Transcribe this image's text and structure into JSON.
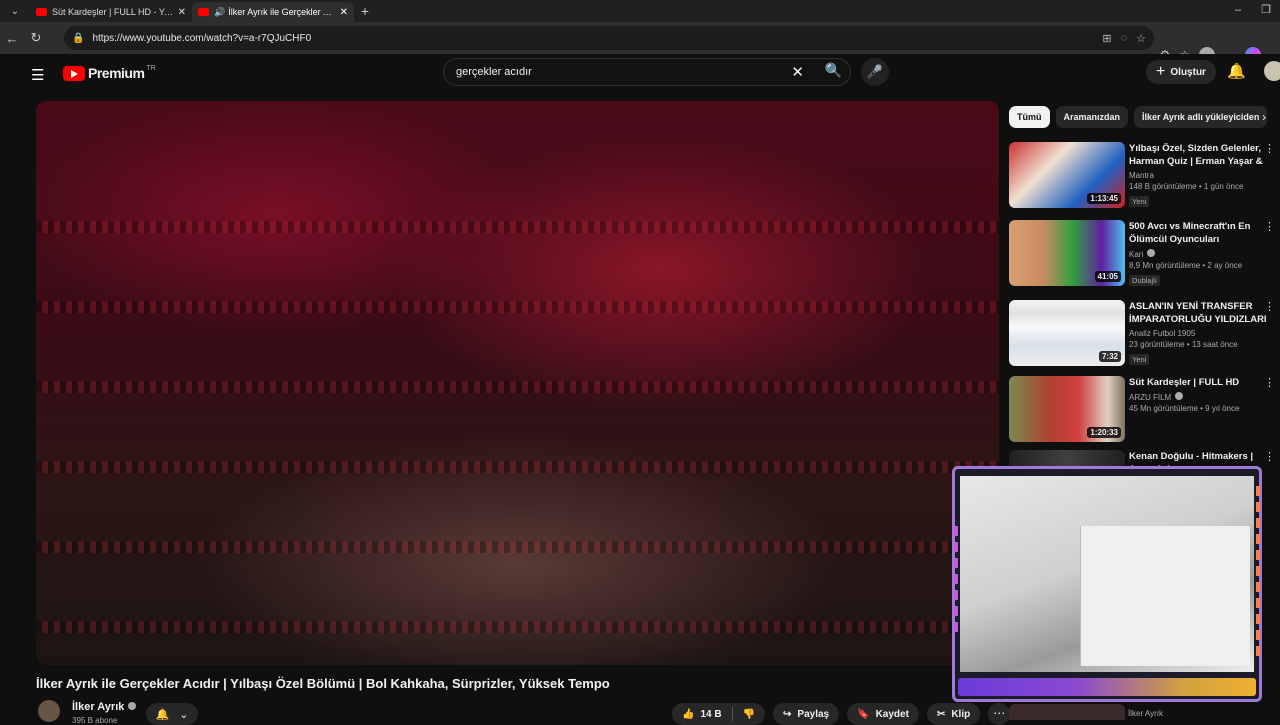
{
  "browser": {
    "tabs": [
      {
        "title": "Süt Kardeşler | FULL HD - YouTube",
        "active": false,
        "audio": false
      },
      {
        "title": "İlker Ayrık ile Gerçekler Acıdır | Yı",
        "active": true,
        "audio": true
      }
    ],
    "url": "https://www.youtube.com/watch?v=a-r7QJuCHF0"
  },
  "header": {
    "logo": "Premium",
    "region": "TR",
    "search_value": "gerçekler acıdır",
    "create_label": "Oluştur"
  },
  "video": {
    "title": "İlker Ayrık ile Gerçekler Acıdır | Yılbaşı Özel Bölümü | Bol Kahkaha, Sürprizler, Yüksek Tempo",
    "channel": "İlker Ayrık",
    "subscribers": "395 B abone",
    "likes": "14 B",
    "share_label": "Paylaş",
    "save_label": "Kaydet",
    "clip_label": "Klip"
  },
  "sidebar": {
    "chips": [
      "Tümü",
      "Aramanızdan",
      "İlker Ayrık adlı yükleyiciden"
    ],
    "recommendations": [
      {
        "title": "Yılbaşı Özel, Sizden Gelenler, Harman Quiz | Erman Yaşar & ...",
        "channel": "Mantra",
        "meta": "148 B görüntüleme • 1 gün önce",
        "badge": "Yeni",
        "duration": "1:13:45",
        "verified": false
      },
      {
        "title": "500 Avcı vs Minecraft'ın En Ölümcül Oyuncuları",
        "channel": "Kari",
        "meta": "8,9 Mn görüntüleme • 2 ay önce",
        "badge": "Dublajlı",
        "duration": "41:05",
        "verified": true
      },
      {
        "title": "ASLAN'IN YENİ TRANSFER İMPARATORLUĞU YILDIZLARI",
        "channel": "Analiz Futbol 1905",
        "meta": "23 görüntüleme • 13 saat önce",
        "badge": "Yeni",
        "duration": "7:32",
        "verified": false
      },
      {
        "title": "Süt Kardeşler | FULL HD",
        "channel": "ARZU FİLM",
        "meta": "45 Mn görüntüleme • 9 yıl önce",
        "badge": "",
        "duration": "1:20:33",
        "verified": true
      },
      {
        "title": "Kenan Doğulu - Hitmakers | Arem & Arman",
        "channel": "",
        "meta": "",
        "badge": "",
        "duration": "",
        "verified": false
      }
    ],
    "next_channel": "İlker Ayrık"
  },
  "colors": {
    "brand": "#ff0000",
    "bg": "#0f0f0f",
    "chip": "#272727"
  }
}
